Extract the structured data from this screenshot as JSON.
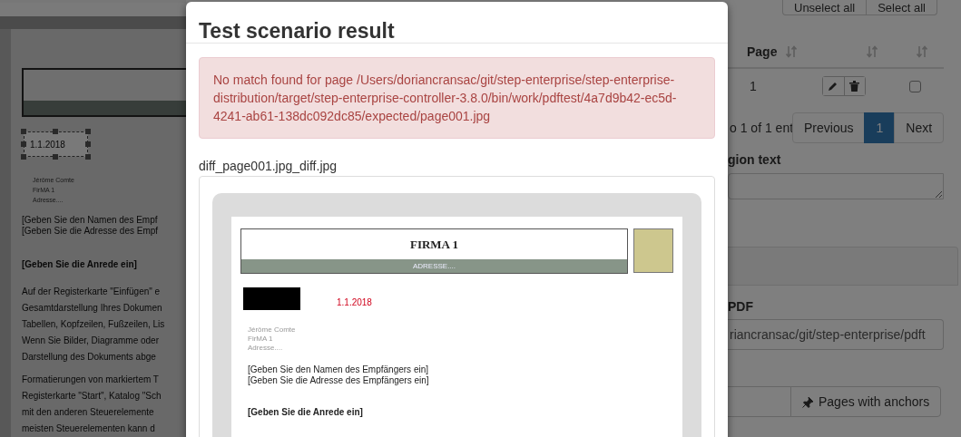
{
  "background": {
    "document_preview": {
      "date": "1.1.2018",
      "sender_lines": [
        "Jérôme Comte",
        "FirMA 1",
        "Adresse...."
      ],
      "recipient_lines": [
        "[Geben Sie den Namen des Empf",
        "[Geben Sie die Adresse des Empf"
      ],
      "salutation": "[Geben Sie die Anrede ein]",
      "paragraphs": [
        [
          "Auf der Registerkarte \"Einfügen\" e",
          "Gesamtdarstellung Ihres Dokumen",
          "Tabellen, Kopfzeilen, Fußzeilen, Lis",
          "Wenn Sie Bilder, Diagramme oder",
          "Darstellung des Dokuments abge"
        ],
        [
          "Formatierungen von markiertem T",
          "Registerkarte \"Start\", Katalog \"Sch",
          "mit den anderen Steuerelemente",
          "meisten Steuerelementen kann d"
        ]
      ]
    },
    "toolbar_buttons": [
      "Unselect all",
      "Select all"
    ],
    "table": {
      "columns": [
        "Page"
      ],
      "rows": [
        {
          "page": "1",
          "checked": false
        }
      ]
    },
    "info": "o 1 of 1 ent",
    "pagination": [
      {
        "label": "Previous",
        "selected": false
      },
      {
        "label": "1",
        "selected": true
      },
      {
        "label": "Next",
        "selected": false
      }
    ],
    "region_text": {
      "label": "gion text"
    },
    "pdf": {
      "label": "PDF",
      "value": "riancransac/git/step-enterprise/pdft"
    },
    "anchors_button": "Pages with anchors"
  },
  "modal": {
    "title": "Test scenario result",
    "alert": "No match found for page /Users/doriancransac/git/step-enterprise/step-enterprise-distribution/target/step-enterprise-controller-3.8.0/bin/work/pdftest/4a7d9b42-ec5d-4241-ab61-138dc092dc85/expected/page001.jpg",
    "image_label": "diff_page001.jpg_diff.jpg",
    "diff_document": {
      "company": "FIRMA 1",
      "address_bar": "ADRESSE....",
      "date": "1.1.2018",
      "sender_lines": [
        "Jérôme Comte",
        "FirMA 1",
        "Adresse...."
      ],
      "recipient_lines": [
        "[Geben Sie den Namen des Empfängers ein]",
        "[Geben Sie die Adresse des Empfängers ein]"
      ],
      "salutation": "[Geben Sie die Anrede ein]"
    }
  }
}
